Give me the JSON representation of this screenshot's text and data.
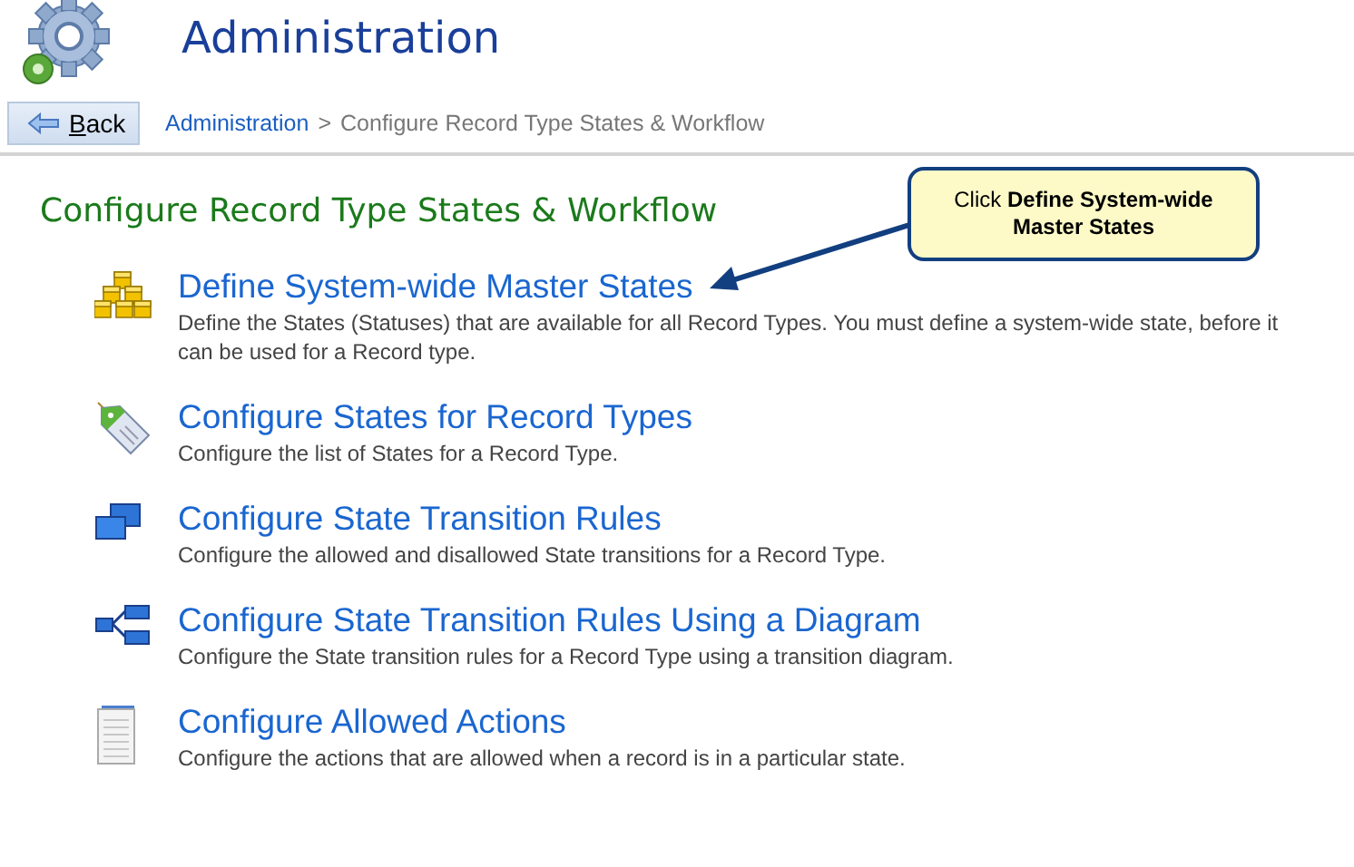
{
  "header": {
    "title": "Administration"
  },
  "back_button": {
    "label": "Back"
  },
  "breadcrumb": [
    {
      "label": "Administration",
      "link": true
    },
    {
      "label": ">",
      "link": false
    },
    {
      "label": "Configure Record Type States & Workflow",
      "link": false
    }
  ],
  "section_title": "Configure Record Type States & Workflow",
  "items": [
    {
      "kind": "cubes",
      "title": "Define System-wide Master States",
      "description": "Define the States (Statuses) that are available for all Record Types. You must define a system-wide state, before it can be used for a Record type."
    },
    {
      "kind": "tag",
      "title": "Configure States for Record Types",
      "description": "Configure the list of States for a Record Type."
    },
    {
      "kind": "windows",
      "title": "Configure State Transition Rules",
      "description": "Configure the allowed and disallowed State transitions for a Record Type."
    },
    {
      "kind": "diagram",
      "title": "Configure State Transition Rules Using a Diagram",
      "description": "Configure the State transition rules for a Record Type using a transition diagram."
    },
    {
      "kind": "document",
      "title": "Configure Allowed Actions",
      "description": "Configure the actions that are allowed when a record is in a particular state."
    }
  ],
  "callout": {
    "text": "Click **Define System-wide Master States**"
  }
}
